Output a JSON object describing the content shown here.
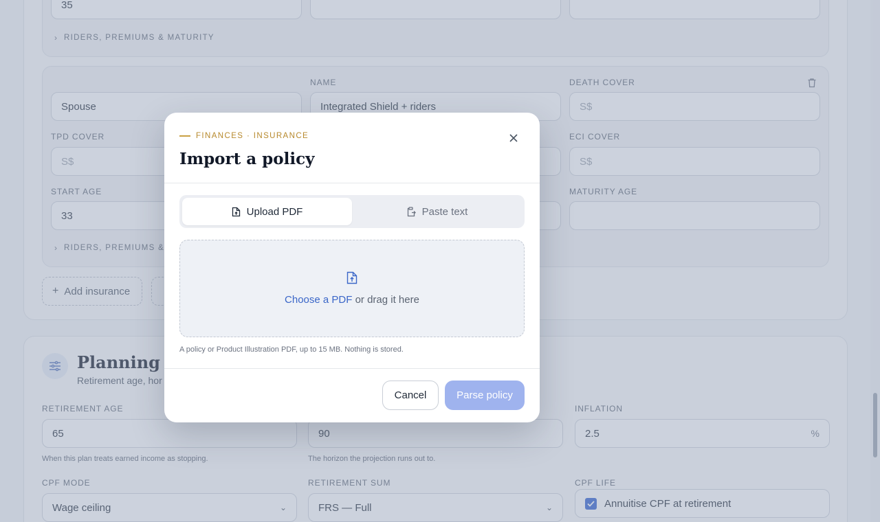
{
  "background": {
    "top_row": {
      "age_value": "35",
      "riders_label": "RIDERS, PREMIUMS & MATURITY"
    },
    "policy2": {
      "name_label": "NAME",
      "death_label": "DEATH COVER",
      "tpd_label": "TPD COVER",
      "eci_label": "ECI COVER",
      "start_age_label": "START AGE",
      "maturity_label": "MATURITY AGE",
      "insured_value": "Spouse",
      "name_value": "Integrated Shield + riders",
      "currency_placeholder": "S$",
      "start_age_value": "33",
      "riders_label": "RIDERS, PREMIUMS & M"
    },
    "add_insurance_label": "Add insurance",
    "planning": {
      "title": "Planning se",
      "subtitle": "Retirement age, hor",
      "retirement_age_label": "RETIREMENT AGE",
      "retirement_age_value": "65",
      "retirement_age_hint": "When this plan treats earned income as stopping.",
      "horizon_value": "90",
      "horizon_hint": "The horizon the projection runs out to.",
      "inflation_label": "INFLATION",
      "inflation_value": "2.5",
      "inflation_unit": "%",
      "cpf_mode_label": "CPF MODE",
      "cpf_mode_value": "Wage ceiling",
      "retirement_sum_label": "RETIREMENT SUM",
      "retirement_sum_value": "FRS — Full",
      "cpf_life_label": "CPF LIFE",
      "cpf_life_checkbox_label": "Annuitise CPF at retirement"
    }
  },
  "modal": {
    "eyebrow": "FINANCES · INSURANCE",
    "title": "Import a policy",
    "tabs": [
      {
        "label": "Upload PDF",
        "active": true
      },
      {
        "label": "Paste text",
        "active": false
      }
    ],
    "dropzone": {
      "link_text": "Choose a PDF",
      "rest_text": " or drag it here"
    },
    "note": "A policy or Product Illustration PDF, up to 15 MB. Nothing is stored.",
    "cancel_label": "Cancel",
    "parse_label": "Parse policy"
  },
  "colors": {
    "accent": "#3a66c8",
    "eyebrow": "#b7892c",
    "primary_disabled": "#9fb3ee",
    "overlay": "rgba(148,160,184,0.48)"
  },
  "icons": {
    "close": "close-icon",
    "upload_file": "file-upload-icon",
    "paste": "clipboard-paste-icon",
    "trash": "trash-icon",
    "plus": "plus-icon",
    "sliders": "sliders-icon",
    "chevron_right": "chevron-right-icon",
    "chevron_down": "chevron-down-icon",
    "check": "check-icon"
  }
}
